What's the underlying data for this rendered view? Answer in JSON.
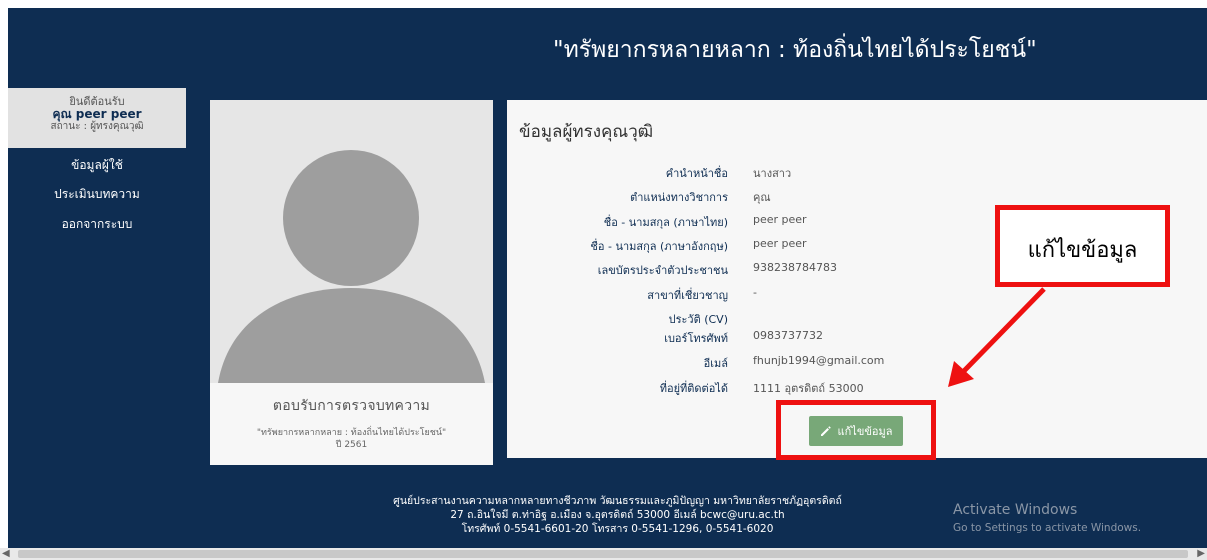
{
  "header": {
    "title": "\"ทรัพยากรหลายหลาก : ท้องถิ่นไทยได้ประโยชน์\""
  },
  "sidebar": {
    "welcome": "ยินดีต้อนรับ",
    "user_name": "คุณ peer peer",
    "status": "สถานะ : ผู้ทรงคุณวุฒิ",
    "items": [
      {
        "label": "ข้อมูลผู้ใช้"
      },
      {
        "label": "ประเมินบทความ"
      },
      {
        "label": "ออกจากระบบ"
      }
    ]
  },
  "profile": {
    "avatar_icon": "user-avatar-placeholder-icon",
    "caption_title": "ตอบรับการตรวจบทความ",
    "project": "\"ทรัพยากรหลากหลาย : ท้องถิ่นไทยได้ประโยชน์\"",
    "year": "ปี 2561"
  },
  "info": {
    "heading": "ข้อมูลผู้ทรงคุณวุฒิ",
    "rows": [
      {
        "label": "คำนำหน้าชื่อ",
        "value": "นางสาว"
      },
      {
        "label": "ตำแหน่งทางวิชาการ",
        "value": "คุณ"
      },
      {
        "label": "ชื่อ - นามสกุล (ภาษาไทย)",
        "value": "peer peer"
      },
      {
        "label": "ชื่อ - นามสกุล (ภาษาอังกฤษ)",
        "value": "peer peer"
      },
      {
        "label": "เลขบัตรประจำตัวประชาชน",
        "value": "938238784783"
      },
      {
        "label": "สาขาที่เชี่ยวชาญ",
        "value": "-"
      },
      {
        "label": "ประวัติ (CV)",
        "value": ""
      },
      {
        "label": "เบอร์โทรศัพท์",
        "value": "0983737732"
      },
      {
        "label": "อีเมล์",
        "value": "fhunjb1994@gmail.com"
      },
      {
        "label": "ที่อยู่ที่ติดต่อได้",
        "value": "1111 อุตรดิตถ์ 53000"
      }
    ],
    "edit_button": "แก้ไขข้อมูล",
    "edit_icon": "pencil-icon"
  },
  "callout": {
    "text": "แก้ไขข้อมูล",
    "color": "#ee1111"
  },
  "footer": {
    "line1": "ศูนย์ประสานงานความหลากหลายทางชีวภาพ วัฒนธรรมและภูมิปัญญา มหาวิทยาลัยราชภัฏอุตรดิตถ์",
    "line2": "27 ถ.อินใจมี ต.ท่าอิฐ อ.เมือง จ.อุตรดิตถ์ 53000 อีเมล์ bcwc@uru.ac.th",
    "line3": "โทรศัพท์ 0-5541-6601-20 โทรสาร 0-5541-1296, 0-5541-6020"
  },
  "watermark": {
    "title": "Activate Windows",
    "subtitle": "Go to Settings to activate Windows."
  },
  "colors": {
    "brand_navy": "#0e2d52",
    "button_green": "#78a878",
    "highlight_red": "#ee1111"
  }
}
